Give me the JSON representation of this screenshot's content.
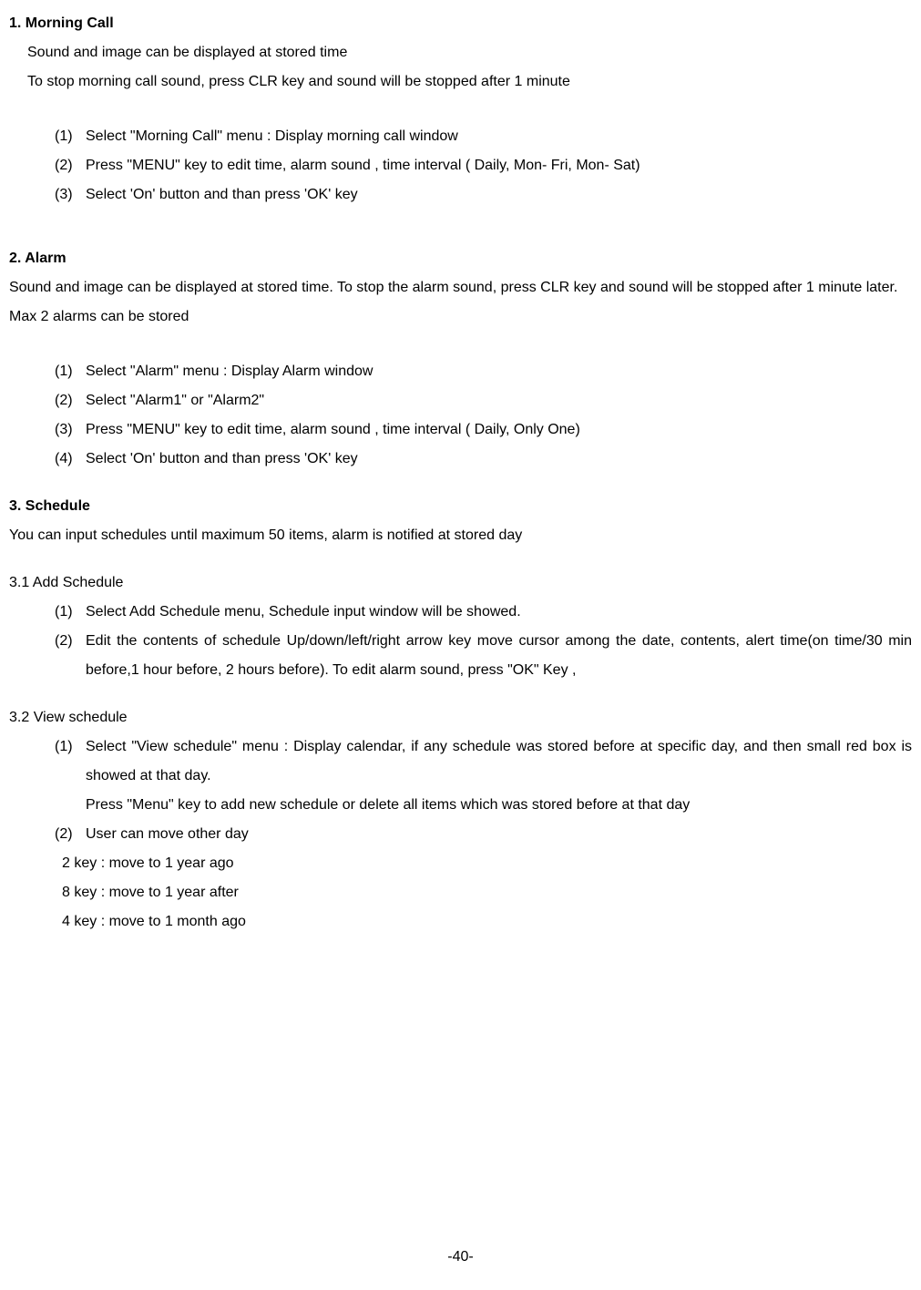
{
  "section1": {
    "heading": "1. Morning Call",
    "intro1": "Sound and image can be displayed at stored time",
    "intro2": "To stop morning call sound, press CLR key and sound will be stopped after 1 minute",
    "steps": [
      {
        "num": "(1)",
        "text": "Select \"Morning Call\" menu : Display morning call window"
      },
      {
        "num": "(2)",
        "text": "Press \"MENU\" key to edit time, alarm sound , time interval ( Daily, Mon- Fri, Mon- Sat)"
      },
      {
        "num": "(3)",
        "text": "Select 'On' button and than press 'OK' key"
      }
    ]
  },
  "section2": {
    "heading": "2. Alarm",
    "intro": "Sound and image can be displayed at stored time. To stop the alarm sound, press CLR key and sound will be stopped after 1 minute later. Max 2 alarms can be stored",
    "steps": [
      {
        "num": "(1)",
        "text": "Select \"Alarm\" menu : Display Alarm window"
      },
      {
        "num": "(2)",
        "text": "Select \"Alarm1\" or \"Alarm2\""
      },
      {
        "num": "(3)",
        "text": "Press \"MENU\" key to edit time, alarm sound , time interval ( Daily, Only One)"
      },
      {
        "num": "(4)",
        "text": "Select 'On' button and than press 'OK' key"
      }
    ]
  },
  "section3": {
    "heading": "3. Schedule",
    "intro": "You can input schedules until maximum 50 items, alarm is notified at stored day",
    "sub1": {
      "heading": "3.1 Add Schedule",
      "steps": [
        {
          "num": "(1)",
          "text": "Select Add Schedule menu, Schedule input window will be showed."
        },
        {
          "num": "(2)",
          "text": "Edit the contents of schedule Up/down/left/right arrow key move cursor among the date, contents, alert time(on time/30 min before,1 hour before, 2 hours before). To edit alarm sound, press \"OK\" Key ,"
        }
      ]
    },
    "sub2": {
      "heading": "3.2 View schedule",
      "steps": [
        {
          "num": "(1)",
          "text": "Select \"View schedule\" menu : Display calendar, if any schedule was stored before at specific day, and then small red box is showed at that day.",
          "extra": " Press \"Menu\" key to add new schedule or delete all items which was stored before at that day"
        },
        {
          "num": "(2)",
          "text": "User can move other day"
        }
      ],
      "keylines": [
        "2 key : move to 1 year ago",
        "8 key : move to 1 year after",
        "4 key : move to 1 month ago"
      ]
    }
  },
  "pageNumber": "-40-"
}
